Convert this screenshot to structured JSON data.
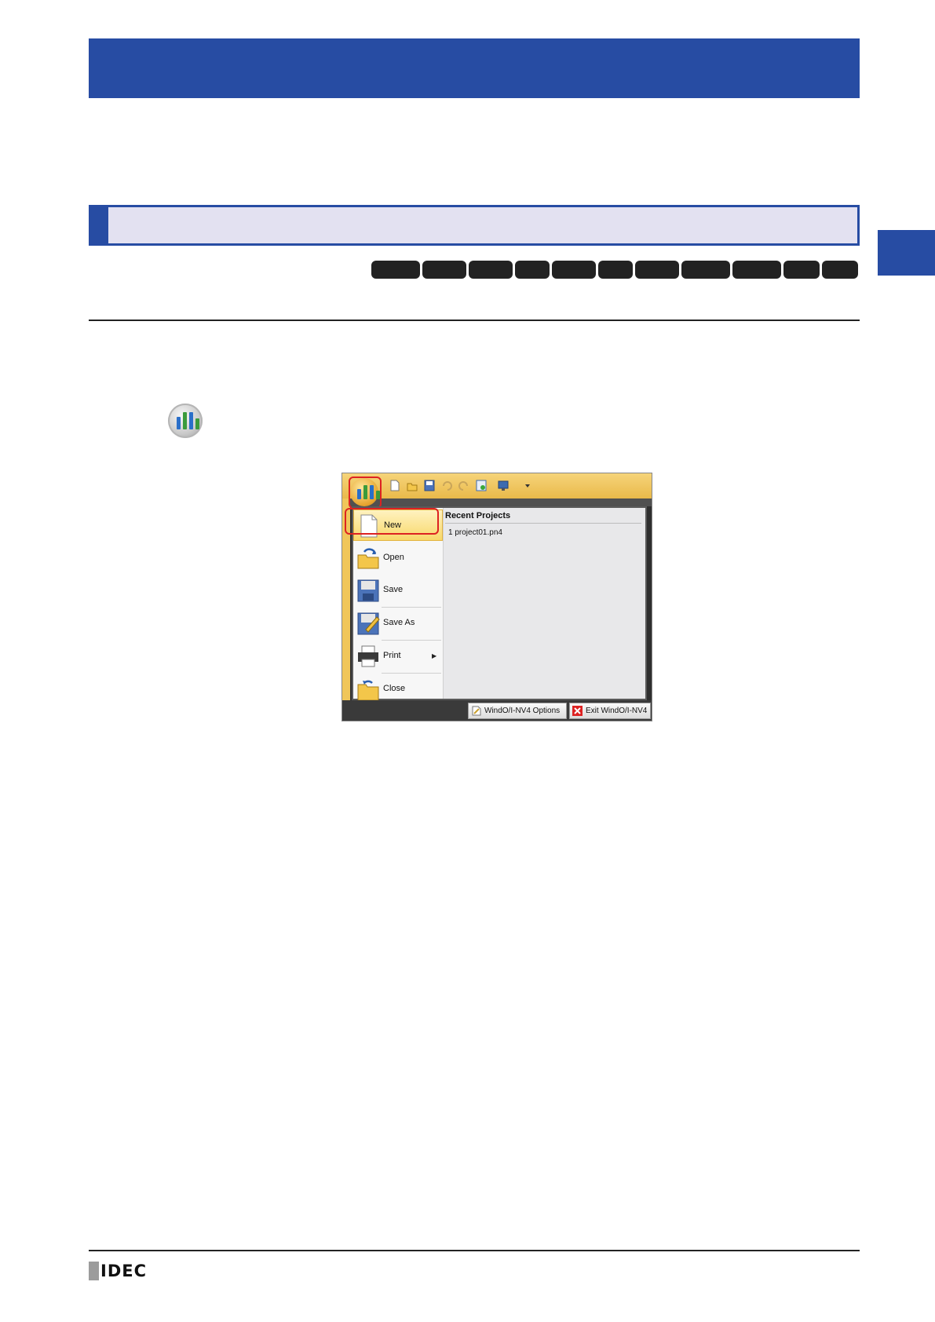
{
  "menu": {
    "commands": [
      {
        "label": "New",
        "icon": "new-document-icon"
      },
      {
        "label": "Open",
        "icon": "open-folder-icon"
      },
      {
        "label": "Save",
        "icon": "floppy-disk-icon"
      },
      {
        "label": "Save As",
        "icon": "save-as-icon"
      },
      {
        "label": "Print",
        "icon": "printer-icon"
      },
      {
        "label": "Close",
        "icon": "close-folder-icon"
      }
    ],
    "recent_header": "Recent Projects",
    "recent_items": [
      "1 project01.pn4"
    ],
    "options_button": "WindO/I-NV4 Options",
    "exit_button": "Exit WindO/I-NV4"
  },
  "footer": {
    "logo_text": "IDEC"
  },
  "colors": {
    "banner": "#274ca3",
    "section_fill": "#e3e1f1",
    "highlight": "#dd2222",
    "ribbon": "#f0c65a"
  }
}
